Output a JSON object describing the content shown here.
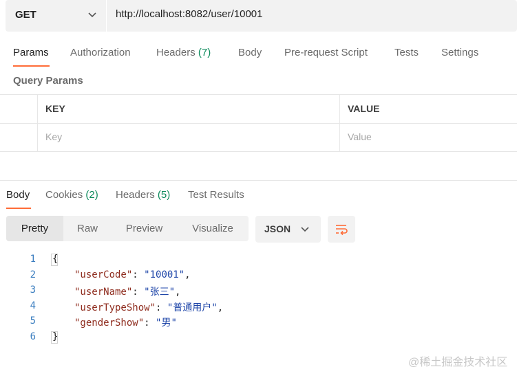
{
  "request": {
    "method": "GET",
    "url": "http://localhost:8082/user/10001"
  },
  "request_tabs": [
    {
      "label": "Params",
      "count": ""
    },
    {
      "label": "Authorization",
      "count": ""
    },
    {
      "label": "Headers ",
      "count": "(7)"
    },
    {
      "label": "Body",
      "count": ""
    },
    {
      "label": "Pre-request Script",
      "count": ""
    },
    {
      "label": "Tests",
      "count": ""
    },
    {
      "label": "Settings",
      "count": ""
    }
  ],
  "query_params": {
    "title": "Query Params",
    "headers": [
      "KEY",
      "VALUE"
    ],
    "placeholders": [
      "Key",
      "Value"
    ]
  },
  "response_tabs": [
    {
      "label": "Body",
      "count": ""
    },
    {
      "label": "Cookies ",
      "count": "(2)"
    },
    {
      "label": "Headers ",
      "count": "(5)"
    },
    {
      "label": "Test Results",
      "count": ""
    }
  ],
  "view_modes": [
    "Pretty",
    "Raw",
    "Preview",
    "Visualize"
  ],
  "format": "JSON",
  "code": {
    "line_numbers": [
      "1",
      "2",
      "3",
      "4",
      "5",
      "6"
    ],
    "open_brace": "{",
    "close_brace": "}",
    "fields": [
      {
        "key": "\"userCode\"",
        "value": "\"10001\"",
        "sep": ","
      },
      {
        "key": "\"userName\"",
        "value": "\"张三\"",
        "sep": ","
      },
      {
        "key": "\"userTypeShow\"",
        "value": "\"普通用户\"",
        "sep": ","
      },
      {
        "key": "\"genderShow\"",
        "value": "\"男\"",
        "sep": ""
      }
    ]
  },
  "watermark": "@稀土掘金技术社区",
  "colors": {
    "accent": "#ff6c37",
    "count": "#0b8a5b",
    "json_key": "#8f2d1f",
    "json_string": "#1e45a8"
  }
}
